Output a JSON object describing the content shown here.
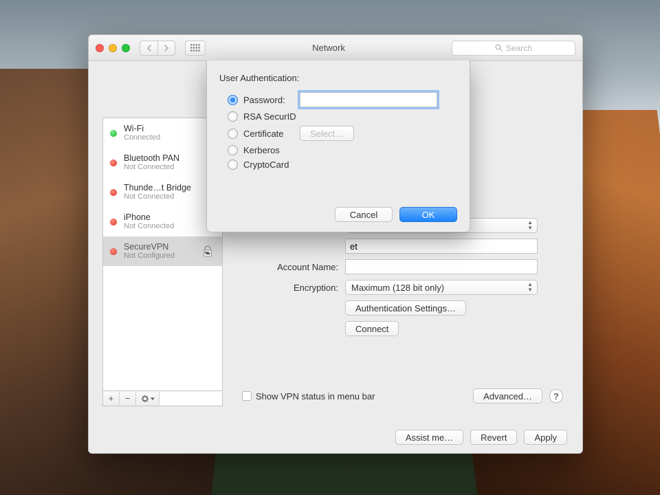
{
  "titlebar": {
    "title": "Network",
    "search_placeholder": "Search"
  },
  "sidebar": {
    "items": [
      {
        "name": "Wi-Fi",
        "status": "Connected",
        "dot": "green2"
      },
      {
        "name": "Bluetooth PAN",
        "status": "Not Connected",
        "dot": "red2"
      },
      {
        "name": "Thunde…t Bridge",
        "status": "Not Connected",
        "dot": "red2"
      },
      {
        "name": "iPhone",
        "status": "Not Connected",
        "dot": "red2"
      },
      {
        "name": "SecureVPN",
        "status": "Not Configured",
        "dot": "red2",
        "selected": true,
        "vpn": true
      }
    ],
    "footer": {
      "add": "+",
      "remove": "−",
      "gear": "✻▾"
    }
  },
  "main": {
    "account_name_label": "Account Name:",
    "account_name_value": "",
    "server_suffix": "et",
    "encryption_label": "Encryption:",
    "encryption_value": "Maximum (128 bit only)",
    "auth_settings_button": "Authentication Settings…",
    "connect_button": "Connect",
    "show_status_label": "Show VPN status in menu bar",
    "advanced_button": "Advanced…"
  },
  "footer": {
    "assist": "Assist me…",
    "revert": "Revert",
    "apply": "Apply"
  },
  "sheet": {
    "title": "User Authentication:",
    "password_label": "Password:",
    "password_value": "",
    "rsa_label": "RSA SecurID",
    "cert_label": "Certificate",
    "cert_select": "Select…",
    "kerberos_label": "Kerberos",
    "cryptocard_label": "CryptoCard",
    "cancel": "Cancel",
    "ok": "OK"
  }
}
